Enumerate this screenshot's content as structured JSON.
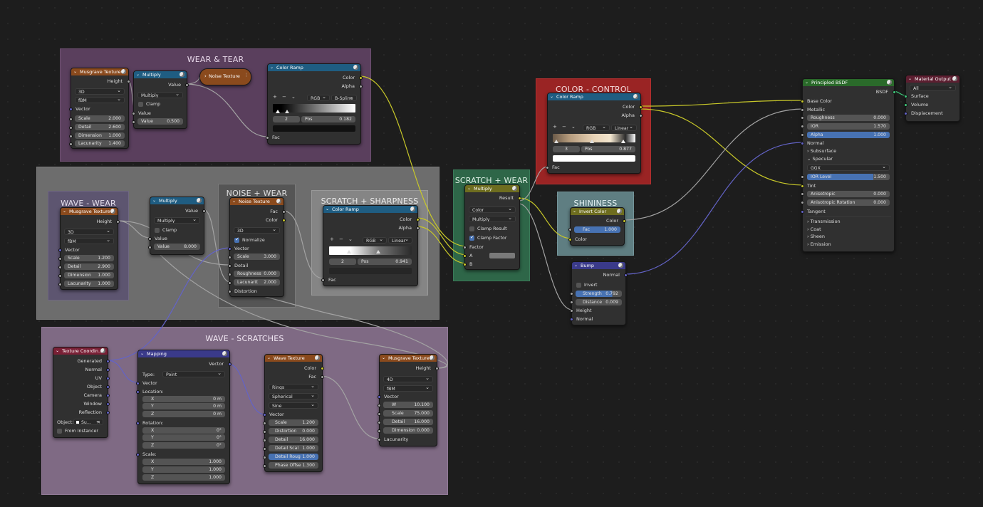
{
  "frames": {
    "wear_tear": "WEAR & TEAR",
    "color_control": "COLOR - CONTROL",
    "scratch_wear": "SCRATCH + WEAR",
    "noise_wear": "NOISE + WEAR",
    "scratch_sharpness": "SCRATCH + SHARPNESS",
    "wave_wear": "WAVE - WEAR",
    "shininess": "SHININESS",
    "wave_scratches": "WAVE - SCRATCHES"
  },
  "colors": {
    "frame_purple": "#5a3f5d",
    "frame_gray": "#6d6d6d",
    "frame_red": "#9a2424",
    "frame_green": "#2e6648",
    "frame_teal": "#5f7e82",
    "frame_lilac": "#7f6a84",
    "header_texture": "#8a4a1d",
    "header_converter": "#1f5d82",
    "header_input": "#7a2036",
    "header_vector": "#3a3a8a",
    "header_shader": "#2a6a2a",
    "header_output": "#5c1e30",
    "header_color": "#6e6d1f"
  },
  "n1": {
    "title": "Musgrave Texture",
    "height": "Height",
    "dim": "3D",
    "type": "fBM",
    "vector": "Vector",
    "f": [
      [
        "Scale",
        "2.000"
      ],
      [
        "Detail",
        "2.600"
      ],
      [
        "Dimension",
        "1.000"
      ],
      [
        "Lacunarity",
        "1.400"
      ]
    ]
  },
  "n2": {
    "title": "Multiply",
    "value_out": "Value",
    "op": "Multiply",
    "clamp": "Clamp",
    "value_in": "Value",
    "v_lbl": "Value",
    "v_val": "0.500"
  },
  "n3": {
    "title": "Noise Texture"
  },
  "n4": {
    "title": "Color Ramp",
    "color": "Color",
    "alpha": "Alpha",
    "mode": "RGB",
    "interp": "B-Spline",
    "idx": "2",
    "pos_lbl": "Pos",
    "pos_val": "0.182",
    "fac": "Fac"
  },
  "n5": {
    "title": "Color Ramp",
    "color": "Color",
    "alpha": "Alpha",
    "mode": "RGB",
    "interp": "Linear",
    "idx": "3",
    "pos_lbl": "Pos",
    "pos_val": "0.877",
    "fac": "Fac"
  },
  "n6": {
    "title": "Principled BSDF",
    "bsdf": "BSDF",
    "base_color": "Base Color",
    "metallic": "Metallic",
    "f": [
      [
        "Roughness",
        "0.000"
      ],
      [
        "IOR",
        "1.570"
      ],
      [
        "Alpha",
        "1.000"
      ]
    ],
    "normal": "Normal",
    "subsurface": "Subsurface",
    "specular": "Specular",
    "dist": "GGX",
    "ior_level_lbl": "IOR Level",
    "ior_level": "1.500",
    "tint": "Tint",
    "aniso": "Anisotropic",
    "aniso_v": "0.000",
    "aniso_rot": "Anisotropic Rotation",
    "aniso_rot_v": "0.000",
    "tangent": "Tangent",
    "transmission": "Transmission",
    "coat": "Coat",
    "sheen": "Sheen",
    "emission": "Emission"
  },
  "n7": {
    "title": "Material Output",
    "target": "All",
    "surface": "Surface",
    "volume": "Volume",
    "displacement": "Displacement"
  },
  "n8": {
    "title": "Musgrave Texture",
    "height": "Height",
    "dim": "3D",
    "type": "fBM",
    "vector": "Vector",
    "f": [
      [
        "Scale",
        "1.200"
      ],
      [
        "Detail",
        "2.900"
      ],
      [
        "Dimension",
        "1.000"
      ],
      [
        "Lacunarity",
        "1.000"
      ]
    ]
  },
  "n9": {
    "title": "Multiply",
    "value_out": "Value",
    "op": "Multiply",
    "clamp": "Clamp",
    "value_in": "Value",
    "v_lbl": "Value",
    "v_val": "8.000"
  },
  "n10": {
    "title": "Noise Texture",
    "fac": "Fac",
    "color": "Color",
    "dim": "3D",
    "normalize": "Normalize",
    "vector": "Vector",
    "scale_lbl": "Scale",
    "scale_val": "3.000",
    "detail": "Detail",
    "rough_lbl": "Roughness",
    "rough_val": "0.000",
    "lac_lbl": "Lacunarit",
    "lac_val": "2.000",
    "distortion": "Distortion"
  },
  "n11": {
    "title": "Color Ramp",
    "color": "Color",
    "alpha": "Alpha",
    "mode": "RGB",
    "interp": "Linear",
    "idx": "2",
    "pos_lbl": "Pos",
    "pos_val": "0.941",
    "fac": "Fac"
  },
  "n12": {
    "title": "Multiply",
    "result": "Result",
    "type": "Color",
    "op": "Multiply",
    "clamp_result": "Clamp Result",
    "clamp_factor": "Clamp Factor",
    "factor": "Factor",
    "a": "A",
    "b": "B"
  },
  "n13": {
    "title": "Invert Color",
    "color_out": "Color",
    "fac_lbl": "Fac",
    "fac_val": "1.000",
    "color_in": "Color"
  },
  "n14": {
    "title": "Bump",
    "normal_out": "Normal",
    "invert": "Invert",
    "strength_lbl": "Strength",
    "strength_val": "0.792",
    "distance_lbl": "Distance",
    "distance_val": "0.009",
    "height": "Height",
    "normal_in": "Normal"
  },
  "n15": {
    "title": "Texture Coordin...",
    "outs": [
      "Generated",
      "Normal",
      "UV",
      "Object",
      "Camera",
      "Window",
      "Reflection"
    ],
    "object_lbl": "Object:",
    "object_val": "Su...",
    "from_instancer": "From Instancer"
  },
  "n16": {
    "title": "Mapping",
    "vector_out": "Vector",
    "type_lbl": "Type:",
    "type_val": "Point",
    "vector_in": "Vector",
    "location": "Location:",
    "rotation": "Rotation:",
    "scale": "Scale:",
    "loc": [
      [
        "X",
        "0 m"
      ],
      [
        "Y",
        "0 m"
      ],
      [
        "Z",
        "0 m"
      ]
    ],
    "rot": [
      [
        "X",
        "0°"
      ],
      [
        "Y",
        "0°"
      ],
      [
        "Z",
        "0°"
      ]
    ],
    "scl": [
      [
        "X",
        "1.000"
      ],
      [
        "Y",
        "1.000"
      ],
      [
        "Z",
        "1.000"
      ]
    ]
  },
  "n17": {
    "title": "Wave Texture",
    "color": "Color",
    "fac": "Fac",
    "type": "Rings",
    "dir": "Spherical",
    "profile": "Sine",
    "vector": "Vector",
    "f": [
      [
        "Scale",
        "1.200"
      ],
      [
        "Distortion",
        "0.000"
      ],
      [
        "Detail",
        "16.000"
      ],
      [
        "Detail Scal",
        "1.000"
      ],
      [
        "Detail Roug",
        "1.000"
      ],
      [
        "Phase Offse",
        "1.300"
      ]
    ]
  },
  "n18": {
    "title": "Musgrave Texture",
    "height": "Height",
    "dim": "4D",
    "type": "fBM",
    "vector": "Vector",
    "f": [
      [
        "W",
        "10.100"
      ],
      [
        "Scale",
        "75.000"
      ],
      [
        "Detail",
        "16.000"
      ],
      [
        "Dimension",
        "0.000"
      ]
    ],
    "lacunarity": "Lacunarity"
  }
}
